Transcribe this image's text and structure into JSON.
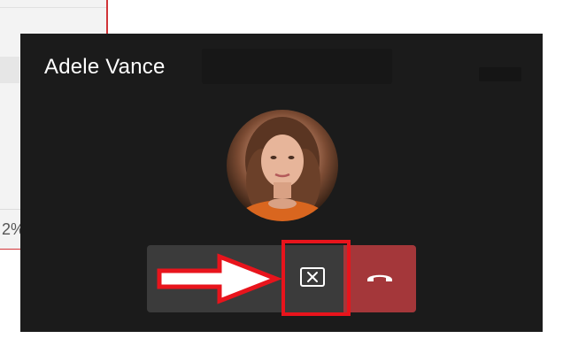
{
  "call": {
    "caller_name": "Adele Vance",
    "background_status_text": "2%"
  },
  "controls": {
    "dismiss_icon": "dismiss-x-icon",
    "end_call_icon": "hang-up-phone-icon"
  },
  "colors": {
    "window_background": "#1b1b1b",
    "control_bar": "#3b3b3b",
    "end_call": "#a4373a",
    "annotation_red": "#e8141c"
  }
}
